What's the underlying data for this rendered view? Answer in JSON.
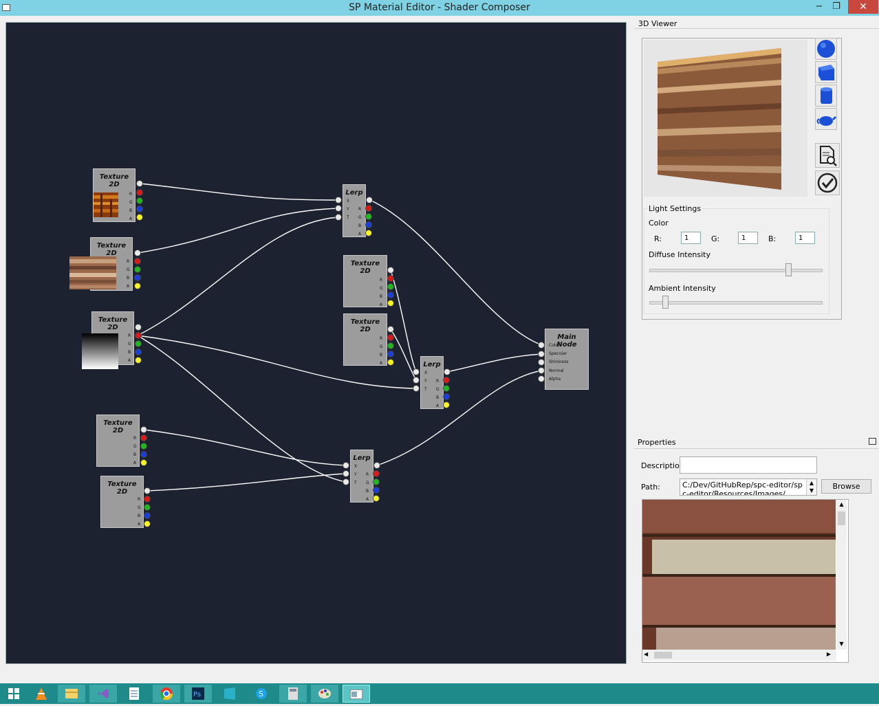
{
  "window": {
    "title": "SP Material Editor - Shader Composer",
    "minimize": "−",
    "restore": "❐",
    "close": "✕"
  },
  "graph": {
    "texture_title": "Texture 2D",
    "lerp_title": "Lerp",
    "main_title": "Main Node",
    "rgba": [
      "R",
      "G",
      "B",
      "A"
    ],
    "lerp_inputs": [
      "X",
      "Y",
      "T"
    ],
    "main_inputs": [
      "Color",
      "Specular",
      "Shininess",
      "Normal",
      "Alpha"
    ]
  },
  "viewer": {
    "title": "3D Viewer",
    "shape_buttons": [
      "sphere-icon",
      "cube-icon",
      "cylinder-icon",
      "teapot-icon"
    ],
    "action_buttons": [
      "document-search-icon",
      "checkmark-icon"
    ]
  },
  "light": {
    "title": "Light Settings",
    "color_label": "Color",
    "r_label": "R:",
    "r_value": "1",
    "g_label": "G:",
    "g_value": "1",
    "b_label": "B:",
    "b_value": "1",
    "diffuse_label": "Diffuse Intensity",
    "diffuse_level": 0.82,
    "ambient_label": "Ambient Intensity",
    "ambient_level": 0.08
  },
  "properties": {
    "title": "Properties",
    "description_label": "Descriptior",
    "description_value": "",
    "path_label": "Path:",
    "path_value": "C:/Dev/GitHubRep/spc-editor/spc-editor/Resources/Images/",
    "browse_label": "Browse"
  },
  "taskbar": {
    "items": [
      "windows-icon",
      "vlc-icon",
      "file-explorer-icon",
      "visual-studio-icon",
      "notepad-icon",
      "chrome-icon",
      "photoshop-icon",
      "store-icon",
      "skype-icon",
      "calculator-icon",
      "paint-icon",
      "active-window-icon"
    ]
  },
  "colors": {
    "canvas": "#1c2230",
    "titlebar": "#7fd2e3",
    "taskbar": "#1f8a8a",
    "node": "#9c9c9c",
    "close": "#c7483c"
  }
}
